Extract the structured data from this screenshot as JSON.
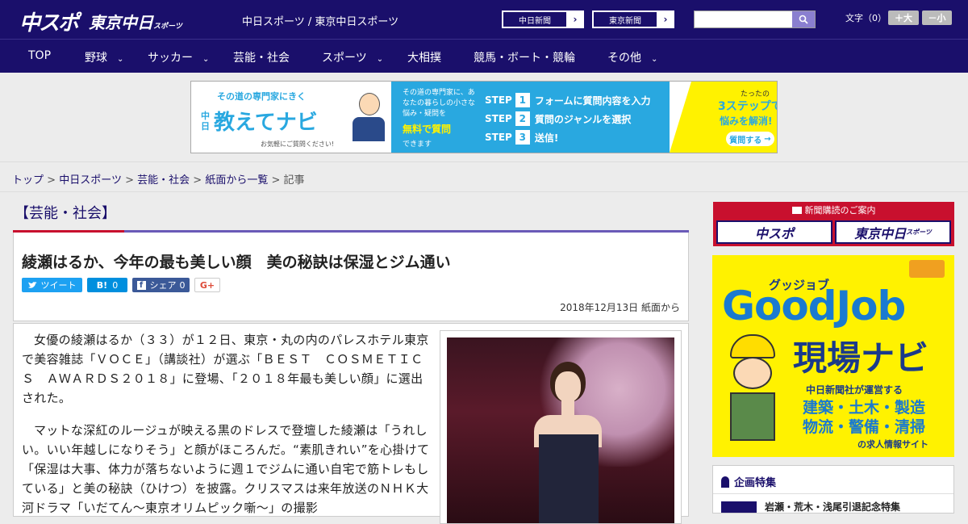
{
  "header": {
    "logo_main": "中スポ",
    "logo_tokyo": "東京中日",
    "logo_tokyo_small": "スポーツ",
    "site_names": "中日スポーツ / 東京中日スポーツ",
    "chunichi_link": "中日新聞",
    "tokyo_link": "東京新聞",
    "search_placeholder": "",
    "font_size_label": "文字（0）",
    "font_up": "＋大",
    "font_down": "－小"
  },
  "nav": {
    "items": [
      {
        "label": "TOP"
      },
      {
        "label": "野球"
      },
      {
        "label": "サッカー"
      },
      {
        "label": "芸能・社会"
      },
      {
        "label": "スポーツ"
      },
      {
        "label": "大相撲"
      },
      {
        "label": "競馬・ボート・競輪"
      },
      {
        "label": "その他"
      }
    ],
    "chevron": "⌄"
  },
  "banner": {
    "tagline": "その道の専門家にきく",
    "brand_small": "中日",
    "brand": "教えてナビ",
    "note": "お気軽にご質問ください!",
    "mid_text": "その道の専門家に、あなたの暮らしの小さな悩み・疑問を",
    "mid_highlight": "無料で質問",
    "mid_tail": "できます",
    "steps": [
      {
        "label": "STEP",
        "num": "1",
        "text": "フォームに質問内容を入力"
      },
      {
        "label": "STEP",
        "num": "2",
        "text": "質問のジャンルを選択"
      },
      {
        "label": "STEP",
        "num": "3",
        "text": "送信!"
      }
    ],
    "right_small": "たったの",
    "right_big": "3ステップで",
    "right_tail": "悩みを解消!",
    "cta": "質問する"
  },
  "breadcrumb": {
    "items": [
      "トップ",
      "中日スポーツ",
      "芸能・社会",
      "紙面から一覧"
    ],
    "separator": ">",
    "current": "記事"
  },
  "article": {
    "category": "【芸能・社会】",
    "title": "綾瀬はるか、今年の最も美しい顔　美の秘訣は保湿とジム通い",
    "share": {
      "tweet": "ツイート",
      "hatena_label": "B!",
      "hatena_count": "0",
      "fb_label": "シェア",
      "fb_count": "0",
      "gplus": "G+"
    },
    "date": "2018年12月13日 紙面から",
    "paragraphs": [
      "女優の綾瀬はるか（３３）が１２日、東京・丸の内のパレスホテル東京で美容雑誌「ＶＯＣＥ」（講談社）が選ぶ「ＢＥＳＴ　ＣＯＳＭＥＴＩＣＳ　ＡＷＡＲＤＳ２０１８」に登場、「２０１８年最も美しい顔」に選出された。",
      "マットな深紅のルージュが映える黒のドレスで登壇した綾瀬は「うれしい。いい年越しになりそう」と顔がほころんだ。“素肌きれい”を心掛けて「保湿は大事、体力が落ちないように週１でジムに通い自宅で筋トレもしている」と美の秘訣（ひけつ）を披露。クリスマスは来年放送のＮＨＫ大河ドラマ「いだてん～東京オリムピック噺～」の撮影"
    ]
  },
  "sidebar": {
    "subscribe_header": "新聞購読のご案内",
    "subscribe_a": "中スポ",
    "subscribe_b": "東京中日",
    "subscribe_b_small": "スポーツ",
    "ad_kana": "グッジョブ",
    "ad_brand": "GoodJob",
    "ad_title": "現場ナビ",
    "ad_org": "中日新聞社が運営する",
    "ad_fields1": "建築・土木・製造",
    "ad_fields2": "物流・警備・清掃",
    "ad_tail": "の求人情報サイト",
    "feature_title": "企画特集",
    "feature_item": "岩瀬・荒木・浅尾引退記念特集"
  },
  "colors": {
    "brand_navy": "#1a0f6b",
    "accent_red": "#c8102e",
    "twitter": "#1da1f2",
    "hatena": "#008fde",
    "facebook": "#3b5998",
    "ad_yellow": "#fff200"
  }
}
